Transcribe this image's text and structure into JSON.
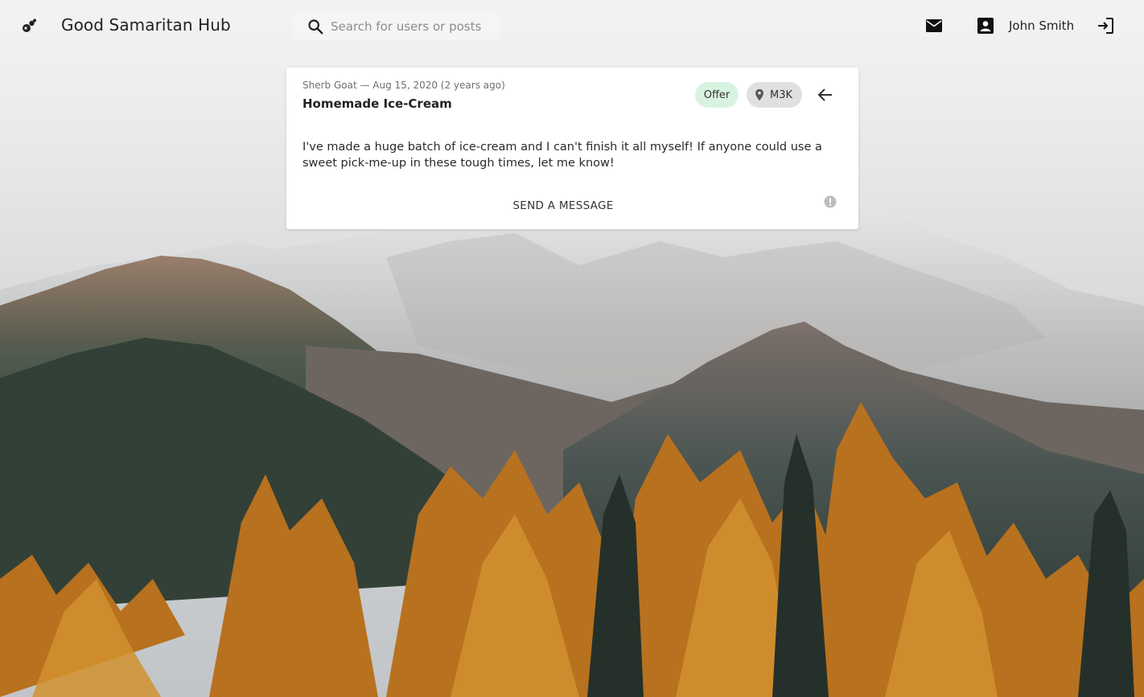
{
  "app": {
    "title": "Good Samaritan Hub",
    "logo_icon": "hands-heart-icon"
  },
  "search": {
    "placeholder": "Search for users or posts",
    "value": "",
    "icon": "search-icon"
  },
  "user": {
    "name": "John Smith",
    "mail_icon": "mail-icon",
    "profile_icon": "account-box-icon",
    "logout_icon": "logout-icon"
  },
  "post": {
    "meta": "Sherb Goat — Aug 15, 2020 (2 years ago)",
    "title": "Homemade Ice-Cream",
    "type_label": "Offer",
    "location": "M3K",
    "body": "I've made a huge batch of ice-cream and I can't finish it all myself! If anyone could use a sweet pick-me-up in these tough times, let me know!",
    "send_label": "SEND A MESSAGE",
    "report_icon": "report-icon",
    "back_icon": "arrow-back-icon"
  },
  "colors": {
    "offer_chip": "#d9f3e1",
    "location_chip": "#e0e0e0",
    "card": "#ffffff",
    "text": "#222222"
  }
}
